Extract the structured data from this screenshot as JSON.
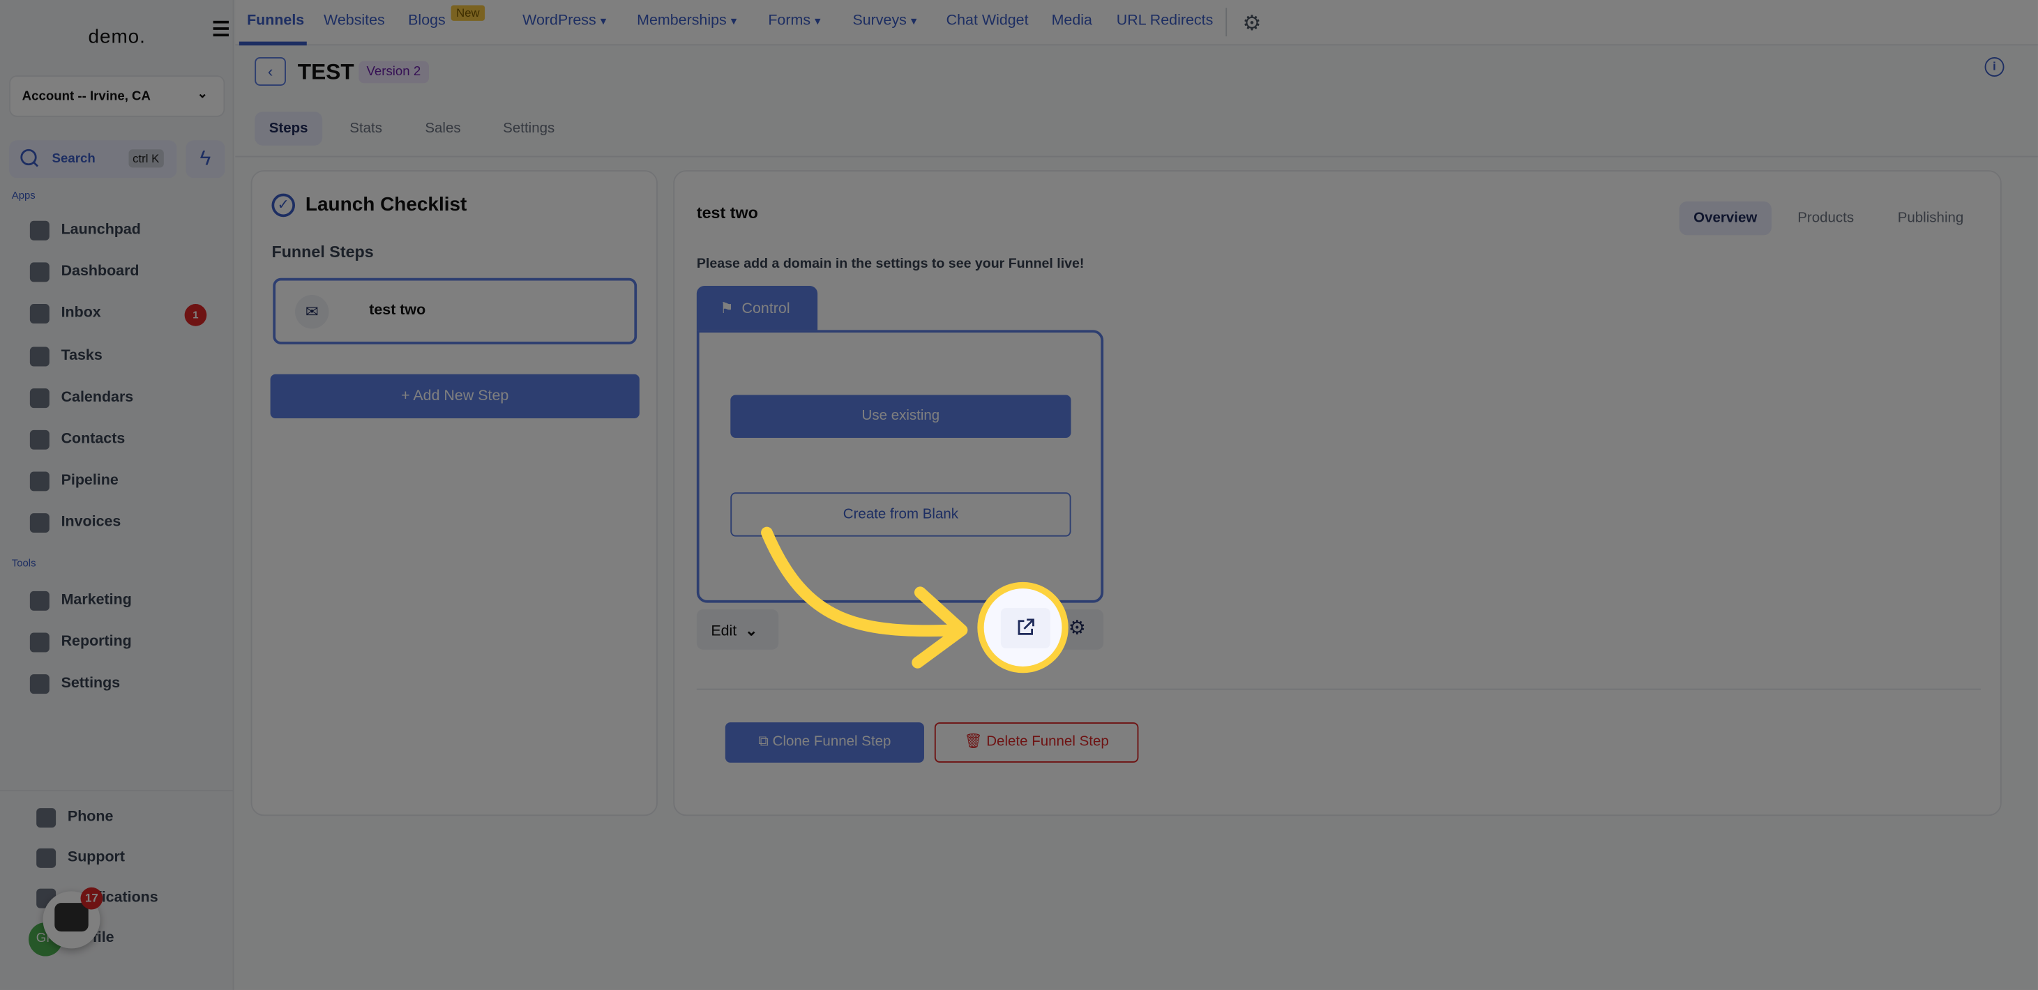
{
  "sidebar": {
    "logo": "demo.",
    "account": "Account -- Irvine, CA",
    "search": {
      "label": "Search",
      "shortcut": "ctrl K"
    },
    "apps_label": "Apps",
    "tools_label": "Tools",
    "apps": [
      {
        "label": "Launchpad",
        "icon": "rocket-icon"
      },
      {
        "label": "Dashboard",
        "icon": "grid-icon"
      },
      {
        "label": "Inbox",
        "icon": "inbox-icon",
        "badge": "1"
      },
      {
        "label": "Tasks",
        "icon": "clipboard-icon"
      },
      {
        "label": "Calendars",
        "icon": "calendar-icon"
      },
      {
        "label": "Contacts",
        "icon": "user-icon"
      },
      {
        "label": "Pipeline",
        "icon": "filter-icon"
      },
      {
        "label": "Invoices",
        "icon": "invoice-icon"
      }
    ],
    "tools": [
      {
        "label": "Marketing",
        "icon": "megaphone-icon"
      },
      {
        "label": "Reporting",
        "icon": "pie-chart-icon"
      },
      {
        "label": "Settings",
        "icon": "settings-icon"
      }
    ],
    "bottom": [
      {
        "label": "Phone",
        "icon": "phone-icon"
      },
      {
        "label": "Support",
        "icon": "chat-icon"
      },
      {
        "label": "Notifications",
        "icon": "bell-icon"
      },
      {
        "label": "Profile",
        "icon": "avatar"
      }
    ],
    "avatar_initials": "GP",
    "chat_badge": "17"
  },
  "topnav": {
    "items": [
      "Funnels",
      "Websites",
      "Blogs",
      "WordPress",
      "Memberships",
      "Forms",
      "Surveys",
      "Chat Widget",
      "Media",
      "URL Redirects"
    ],
    "new_badge": "New",
    "active": "Funnels"
  },
  "header": {
    "title": "TEST",
    "version": "Version 2",
    "tabs": [
      "Steps",
      "Stats",
      "Sales",
      "Settings"
    ],
    "active_tab": "Steps"
  },
  "checklist": {
    "title": "Launch Checklist",
    "steps_label": "Funnel Steps",
    "steps": [
      "test two"
    ],
    "add_step": "+ Add New Step"
  },
  "step": {
    "title": "test two",
    "tabs": [
      "Overview",
      "Products",
      "Publishing"
    ],
    "active_tab": "Overview",
    "notice": "Please add a domain in the settings to see your Funnel live!",
    "variant_tab": "Control",
    "use_existing": "Use existing",
    "create_blank": "Create from Blank",
    "edit": "Edit",
    "clone": "Clone Funnel Step",
    "delete": "Delete Funnel Step"
  },
  "colors": {
    "primary": "#5a7ce0",
    "danger": "#dc2626",
    "highlight": "#fdd23e"
  }
}
